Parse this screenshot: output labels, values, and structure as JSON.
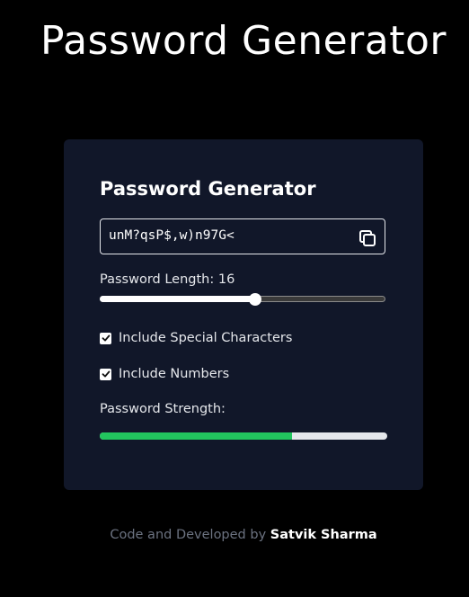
{
  "header": {
    "title": "Password Generator"
  },
  "card": {
    "title": "Password Generator",
    "password": "unM?qsP$,w)n97G<",
    "length_label": "Password Length: 16",
    "length_value": 16,
    "length_min": 4,
    "length_max": 26,
    "options": [
      {
        "label": "Include Special Characters",
        "checked": true
      },
      {
        "label": "Include Numbers",
        "checked": true
      }
    ],
    "strength_label": "Password Strength:",
    "strength_fraction": 0.67,
    "strength_color": "#22c55e"
  },
  "footer": {
    "text": "Code and Developed by ",
    "author": "Satvik Sharma"
  },
  "icons": {
    "copy": "copy-icon",
    "check": "check-icon"
  }
}
